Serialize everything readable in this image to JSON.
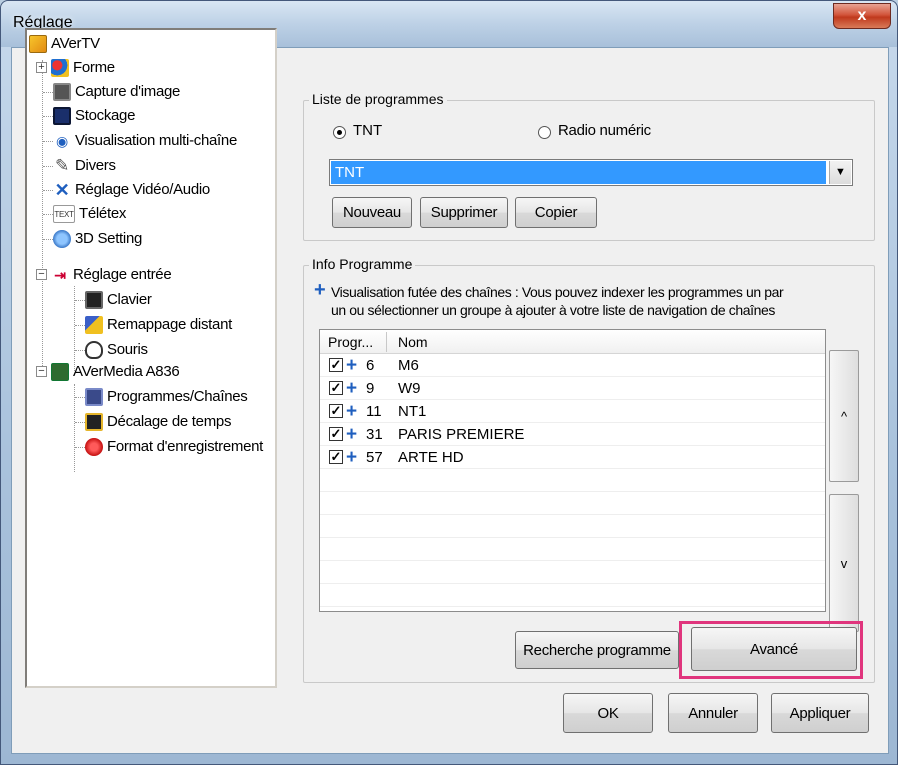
{
  "window": {
    "title": "Réglage",
    "close_label": "x"
  },
  "tree": {
    "items": [
      {
        "label": "AVerTV",
        "icon": "avertv-logo-icon"
      },
      {
        "label": "Forme",
        "icon": "skin-icon"
      },
      {
        "label": "Capture d'image",
        "icon": "camera-icon"
      },
      {
        "label": "Stockage",
        "icon": "floppy-icon"
      },
      {
        "label": "Visualisation multi-chaîne",
        "icon": "eye-icon"
      },
      {
        "label": "Divers",
        "icon": "wrench-icon"
      },
      {
        "label": "Réglage Vidéo/Audio",
        "icon": "tools-icon"
      },
      {
        "label": "Télétex",
        "icon": "teletext-icon"
      },
      {
        "label": "3D Setting",
        "icon": "gear-3d-icon"
      },
      {
        "label": "Réglage entrée",
        "icon": "input-icon"
      },
      {
        "label": "Clavier",
        "icon": "keyboard-icon"
      },
      {
        "label": "Remappage distant",
        "icon": "remote-icon"
      },
      {
        "label": "Souris",
        "icon": "mouse-icon"
      },
      {
        "label": "AVerMedia A836",
        "icon": "device-icon"
      },
      {
        "label": "Programmes/Chaînes",
        "icon": "channel-icon"
      },
      {
        "label": "Décalage de temps",
        "icon": "timeshift-icon"
      },
      {
        "label": "Format d'enregistrement",
        "icon": "record-icon"
      }
    ],
    "teletext_badge": "TEXT"
  },
  "program_list": {
    "group_label": "Liste de programmes",
    "radio_tnt": "TNT",
    "radio_radio": "Radio numéric",
    "selected_list": "TNT",
    "buttons": {
      "new": "Nouveau",
      "delete": "Supprimer",
      "copy": "Copier"
    }
  },
  "program_info": {
    "group_label": "Info Programme",
    "hint_line1": "Visualisation futée des chaînes : Vous pouvez indexer les programmes un par",
    "hint_line2": "un ou sélectionner un groupe à ajouter à votre liste de navigation de chaînes",
    "columns": {
      "prog": "Progr...",
      "name": "Nom"
    },
    "rows": [
      {
        "num": "6",
        "name": "M6",
        "checked": true
      },
      {
        "num": "9",
        "name": "W9",
        "checked": true
      },
      {
        "num": "11",
        "name": "NT1",
        "checked": true
      },
      {
        "num": "31",
        "name": "PARIS PREMIERE",
        "checked": true
      },
      {
        "num": "57",
        "name": "ARTE HD",
        "checked": true
      }
    ],
    "move_up": "^",
    "move_down": "v",
    "search_button": "Recherche programme",
    "advanced_button": "Avancé"
  },
  "footer": {
    "ok": "OK",
    "cancel": "Annuler",
    "apply": "Appliquer"
  },
  "colors": {
    "selection": "#3399ff",
    "highlight_box": "#e0357d",
    "plus_blue": "#1f5fbf"
  }
}
